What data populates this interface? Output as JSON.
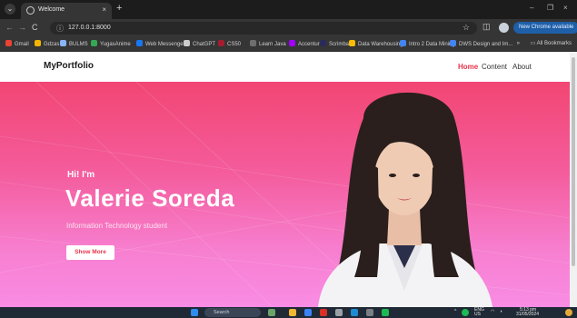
{
  "browser": {
    "tab_title": "Welcome",
    "tab_close": "×",
    "new_tab": "+",
    "win_min": "–",
    "win_max": "❐",
    "win_close": "×",
    "url": "127.0.0.1:8000",
    "update_label": "New Chrome available",
    "nav_back": "←",
    "nav_forward": "→",
    "nav_reload": "C",
    "star": "☆",
    "extensions": "◫",
    "bookmarks": [
      {
        "label": "Gmail",
        "color": "#ea4335"
      },
      {
        "label": "Gdzas",
        "color": "#f4b400"
      },
      {
        "label": "BULMS",
        "color": "#8ab4f8"
      },
      {
        "label": "YugasAnime",
        "color": "#34a853"
      },
      {
        "label": "Web Messenger",
        "color": "#1877f2"
      },
      {
        "label": "ChatGPT",
        "color": "#cccccc"
      },
      {
        "label": "CS50",
        "color": "#a51c30"
      },
      {
        "label": "Learn Java",
        "color": "#6f6f6f"
      },
      {
        "label": "Accenture",
        "color": "#a100ff"
      },
      {
        "label": "Scrimba",
        "color": "#2b2b5a"
      },
      {
        "label": "Data Warehousing",
        "color": "#fbbc04"
      },
      {
        "label": "Intro 2 Data Mining",
        "color": "#4285f4"
      },
      {
        "label": "DWS Design and Im...",
        "color": "#4285f4"
      }
    ],
    "more_bookmarks": "»",
    "all_bookmarks": "All Bookmarks"
  },
  "site": {
    "brand": "MyPortfolio",
    "nav": [
      {
        "label": "Home",
        "active": true
      },
      {
        "label": "Content",
        "active": false
      },
      {
        "label": "About",
        "active": false
      }
    ]
  },
  "hero": {
    "greeting": "Hi! I'm",
    "name": "Valerie Soreda",
    "role": "Information Technology student",
    "cta": "Show More"
  },
  "taskbar": {
    "search_placeholder": "Search",
    "lang": "ENG",
    "region": "US",
    "time": "5:13 pm",
    "date": "31/05/2024",
    "tray_chevron": "^",
    "wifi": "◠",
    "volume": "◖"
  },
  "colors": {
    "accent": "#e8334a",
    "hero_top": "#f24673",
    "hero_bottom": "#f98ce4"
  }
}
